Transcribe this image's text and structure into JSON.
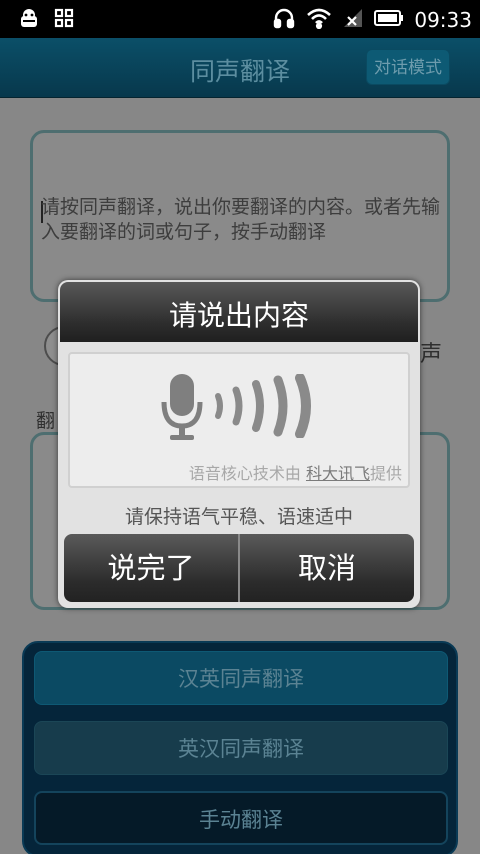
{
  "status_bar": {
    "time": "09:33",
    "left_icons": [
      "android-debug-icon",
      "qr-grid-icon"
    ],
    "right_icons": [
      "headphones-icon",
      "wifi-icon",
      "signal-icon",
      "battery-icon"
    ]
  },
  "header": {
    "title": "同声翻译",
    "mode_button": "对话模式"
  },
  "input": {
    "placeholder_text": "请按同声翻译，说出你要翻译的内容。或者先输入要翻译的词或句子，按手动翻译"
  },
  "radio": {
    "visible_tail": "声"
  },
  "result": {
    "label": "翻"
  },
  "buttons": {
    "cn_en": "汉英同声翻译",
    "en_cn": "英汉同声翻译",
    "manual": "手动翻译"
  },
  "dialog": {
    "title": "请说出内容",
    "credit_prefix": "语音核心技术由 ",
    "credit_brand": "科大讯飞",
    "credit_suffix": "提供",
    "hint": "请保持语气平稳、语速适中",
    "done_button": "说完了",
    "cancel_button": "取消"
  }
}
